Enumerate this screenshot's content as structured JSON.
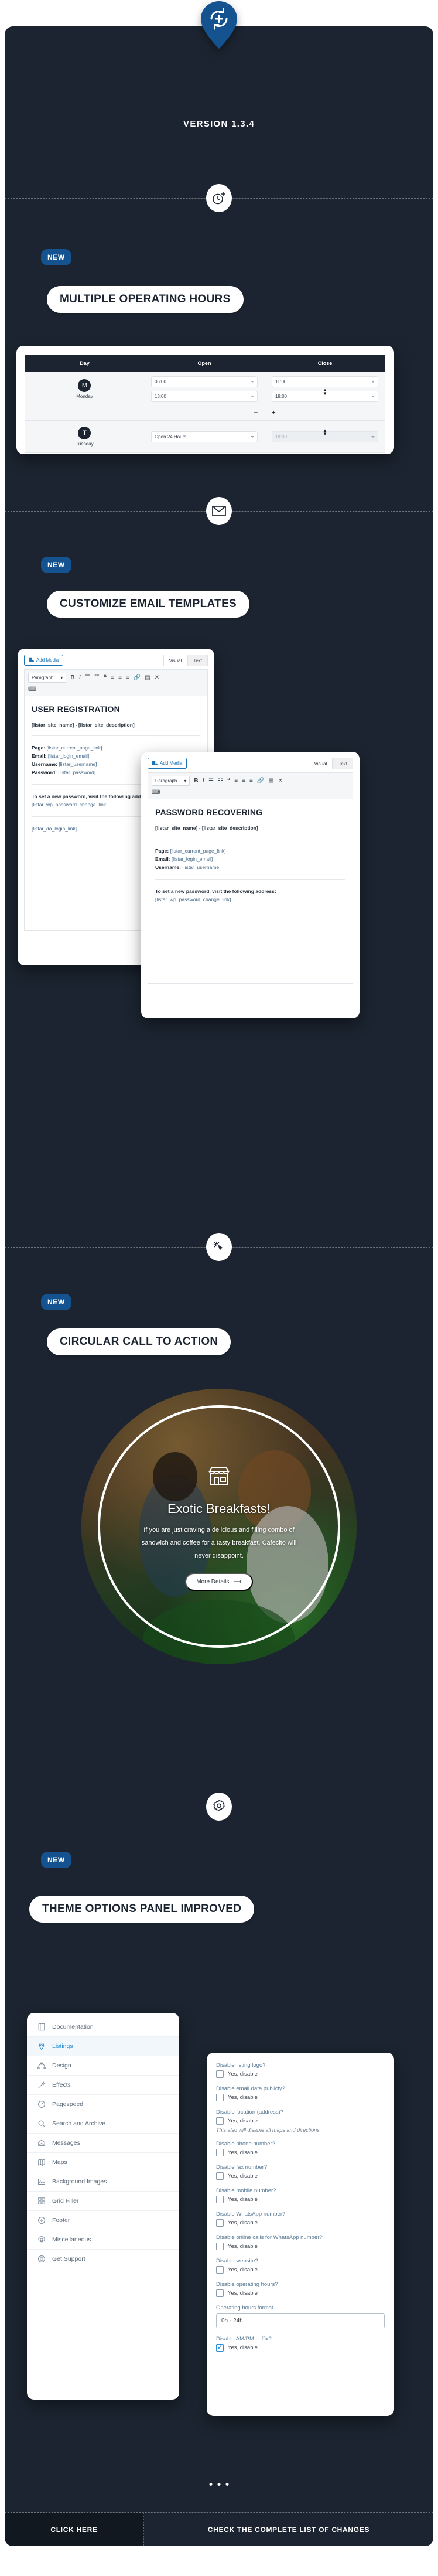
{
  "header": {
    "version_title": "VERSION 1.3.4",
    "pin_icon": "refresh-plus-icon"
  },
  "sections": [
    {
      "icon": "clock-plus-icon",
      "badge": "NEW",
      "title": "MULTIPLE OPERATING HOURS"
    },
    {
      "icon": "envelope-icon",
      "badge": "NEW",
      "title": "CUSTOMIZE EMAIL TEMPLATES"
    },
    {
      "icon": "cursor-click-icon",
      "badge": "NEW",
      "title": "CIRCULAR CALL TO ACTION"
    },
    {
      "icon": "gear-icon",
      "badge": "NEW",
      "title": "THEME OPTIONS PANEL IMPROVED"
    }
  ],
  "hours_table": {
    "columns": [
      "Day",
      "Open",
      "Close"
    ],
    "rows": [
      {
        "initial": "M",
        "day": "Monday",
        "slots": [
          {
            "open": "06:00",
            "close": "11:00"
          },
          {
            "open": "13:00",
            "close": "18:00"
          }
        ],
        "remove_label": "−",
        "add_label": "+"
      },
      {
        "initial": "T",
        "day": "Tuesday",
        "slots": [
          {
            "open": "Open 24 Hours",
            "close": "18:00",
            "close_disabled": true
          }
        ]
      }
    ]
  },
  "editors": [
    {
      "add_media": "Add Media",
      "tabs": [
        "Visual",
        "Text"
      ],
      "active_tab": "Visual",
      "format_select": "Paragraph",
      "toolbar_icons": [
        "bold-icon",
        "italic-icon",
        "bulleted-list-icon",
        "numbered-list-icon",
        "blockquote-icon",
        "align-left-icon",
        "align-center-icon",
        "align-right-icon",
        "link-icon",
        "read-more-icon",
        "fullscreen-icon",
        "keyboard-icon"
      ],
      "heading": "USER REGISTRATION",
      "site_line": "[listar_site_name] - [listar_site_description]",
      "fields": [
        {
          "label": "Page:",
          "token": "[listar_current_page_link]"
        },
        {
          "label": "Email:",
          "token": "[listar_login_email]"
        },
        {
          "label": "Username:",
          "token": "[listar_username]"
        },
        {
          "label": "Password:",
          "token": "[listar_password]"
        }
      ],
      "reset_text": "To set a new password, visit the following address:",
      "reset_link": "[listar_wp_password_change_link]",
      "login_link": "[listar_do_login_link]"
    },
    {
      "add_media": "Add Media",
      "tabs": [
        "Visual",
        "Text"
      ],
      "active_tab": "Visual",
      "format_select": "Paragraph",
      "heading": "PASSWORD RECOVERING",
      "site_line": "[listar_site_name] - [listar_site_description]",
      "fields": [
        {
          "label": "Page:",
          "token": "[listar_current_page_link]"
        },
        {
          "label": "Email:",
          "token": "[listar_login_email]"
        },
        {
          "label": "Username:",
          "token": "[listar_username]"
        }
      ],
      "reset_text": "To set a new password, visit the following address:",
      "reset_link": "[listar_wp_password_change_link]"
    }
  ],
  "cta": {
    "store_icon": "storefront-icon",
    "title": "Exotic Breakfasts!",
    "description": "If you are just craving a delicious and filling combo of sandwich and coffee for a tasty breakfast, Cafecito will never disappoint.",
    "button_label": "More Details",
    "button_icon": "arrow-right-icon"
  },
  "theme_options": {
    "sidebar": [
      {
        "label": "Documentation",
        "icon": "book-icon",
        "active": false
      },
      {
        "label": "Listings",
        "icon": "map-pin-icon",
        "active": true
      },
      {
        "label": "Design",
        "icon": "bezier-icon",
        "active": false
      },
      {
        "label": "Effects",
        "icon": "magic-wand-icon",
        "active": false
      },
      {
        "label": "Pagespeed",
        "icon": "speedometer-icon",
        "active": false
      },
      {
        "label": "Search and Archive",
        "icon": "search-icon",
        "active": false
      },
      {
        "label": "Messages",
        "icon": "open-envelope-icon",
        "active": false
      },
      {
        "label": "Maps",
        "icon": "map-icon",
        "active": false
      },
      {
        "label": "Background Images",
        "icon": "image-icon",
        "active": false
      },
      {
        "label": "Grid Filler",
        "icon": "grid-icon",
        "active": false
      },
      {
        "label": "Footer",
        "icon": "arrow-down-circle-icon",
        "active": false
      },
      {
        "label": "Miscellaneous",
        "icon": "gear-icon",
        "active": false
      },
      {
        "label": "Get Support",
        "icon": "lifebuoy-icon",
        "active": false
      }
    ],
    "options": [
      {
        "question": "Disable listing logo?",
        "answer": "Yes, disable",
        "checked": false
      },
      {
        "question": "Disable email data publicly?",
        "answer": "Yes, disable",
        "checked": false
      },
      {
        "question": "Disable location (address)?",
        "answer": "Yes, disable",
        "checked": false,
        "note": "This also will disable all maps and directions."
      },
      {
        "question": "Disable phone number?",
        "answer": "Yes, disable",
        "checked": false
      },
      {
        "question": "Disable fax number?",
        "answer": "Yes, disable",
        "checked": false
      },
      {
        "question": "Disable mobile number?",
        "answer": "Yes, disable",
        "checked": false
      },
      {
        "question": "Disable WhatsApp number?",
        "answer": "Yes, disable",
        "checked": false
      },
      {
        "question": "Disable online calls for WhatsApp number?",
        "answer": "Yes, disable",
        "checked": false
      },
      {
        "question": "Disable website?",
        "answer": "Yes, disable",
        "checked": false
      },
      {
        "question": "Disable operating hours?",
        "answer": "Yes, disable",
        "checked": false
      },
      {
        "question": "Operating hours format",
        "input_value": "0h - 24h",
        "type": "input"
      },
      {
        "question": "Disable AM/PM suffix?",
        "answer": "Yes, disable",
        "checked": true
      }
    ]
  },
  "footer": {
    "left_label": "CLICK HERE",
    "right_label": "CHECK THE COMPLETE LIST OF CHANGES"
  }
}
